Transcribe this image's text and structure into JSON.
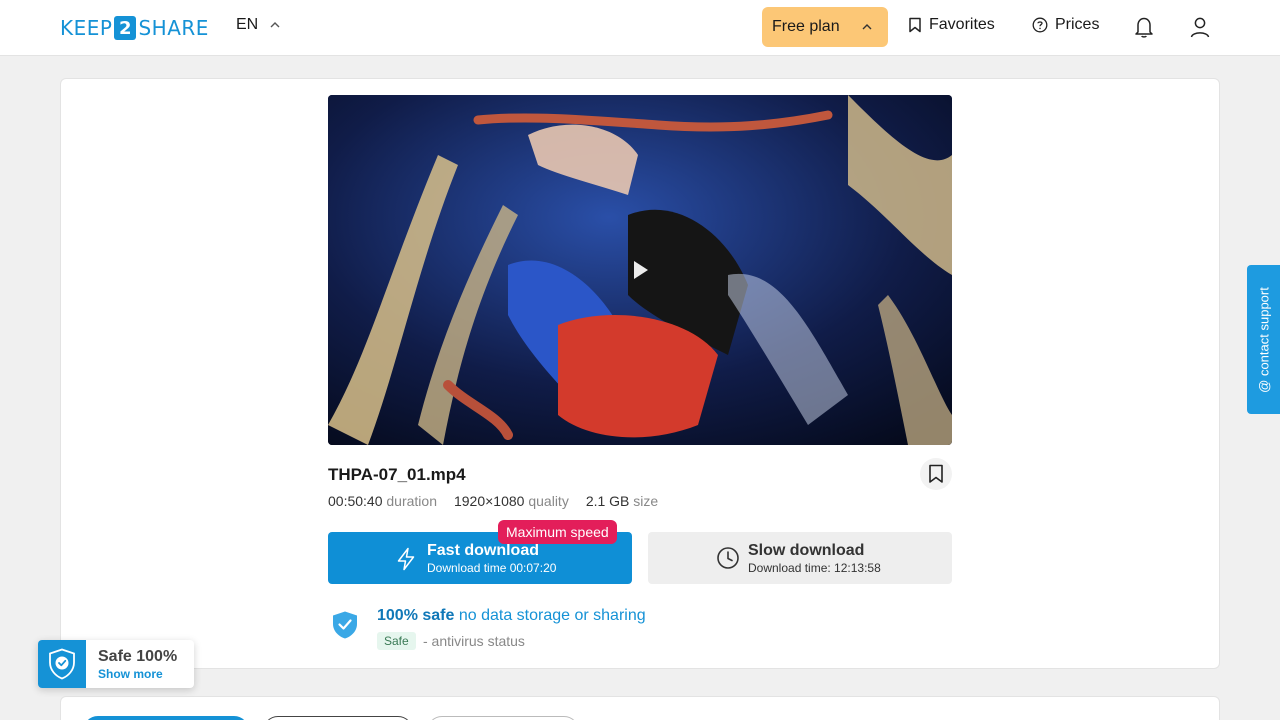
{
  "header": {
    "logo": {
      "left": "KEEP",
      "mid": "2",
      "right": "SHARE"
    },
    "language": "EN",
    "plan_label": "Free plan",
    "favorites_label": "Favorites",
    "prices_label": "Prices"
  },
  "file": {
    "name": "THPA-07_01.mp4",
    "duration_value": "00:50:40",
    "duration_label": "duration",
    "quality_value": "1920×1080",
    "quality_label": "quality",
    "size_value": "2.1 GB",
    "size_label": "size"
  },
  "downloads": {
    "fast_title": "Fast download",
    "fast_time": "Download time 00:07:20",
    "fast_badge": "Maximum speed",
    "slow_title": "Slow download",
    "slow_time": "Download time: 12:13:58"
  },
  "safety": {
    "strong": "100% safe",
    "rest": " no data storage or sharing",
    "badge": "Safe",
    "status": "- antivirus status"
  },
  "support": {
    "label": "@ contact support"
  },
  "safe_widget": {
    "title": "Safe 100%",
    "link": "Show more"
  },
  "colors": {
    "accent": "#1592d6",
    "plan": "#fcc776",
    "badge": "#e31e5a"
  }
}
